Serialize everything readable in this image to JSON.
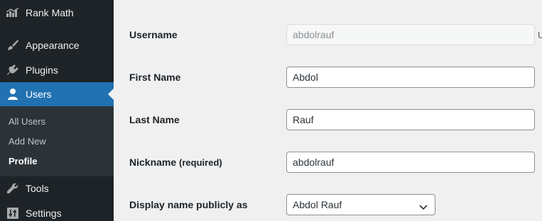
{
  "sidebar": {
    "items": [
      {
        "label": "Rank Math",
        "icon": "rank-math-icon"
      },
      {
        "label": "Appearance",
        "icon": "paintbrush-icon"
      },
      {
        "label": "Plugins",
        "icon": "plugin-icon"
      },
      {
        "label": "Users",
        "icon": "user-icon"
      },
      {
        "label": "Tools",
        "icon": "wrench-icon"
      },
      {
        "label": "Settings",
        "icon": "settings-icon"
      }
    ],
    "submenu": [
      "All Users",
      "Add New",
      "Profile"
    ]
  },
  "form": {
    "username": {
      "label": "Username",
      "value": "abdolrauf",
      "note": "U"
    },
    "first_name": {
      "label": "First Name",
      "value": "Abdol"
    },
    "last_name": {
      "label": "Last Name",
      "value": "Rauf"
    },
    "nickname": {
      "label": "Nickname",
      "required": "(required)",
      "value": "abdolrauf"
    },
    "display_name": {
      "label": "Display name publicly as",
      "value": "Abdol Rauf"
    }
  },
  "colors": {
    "sidebar": "#1d2327",
    "submenu": "#2c3338",
    "accent": "#2271b1",
    "page_bg": "#f0f0f1"
  }
}
